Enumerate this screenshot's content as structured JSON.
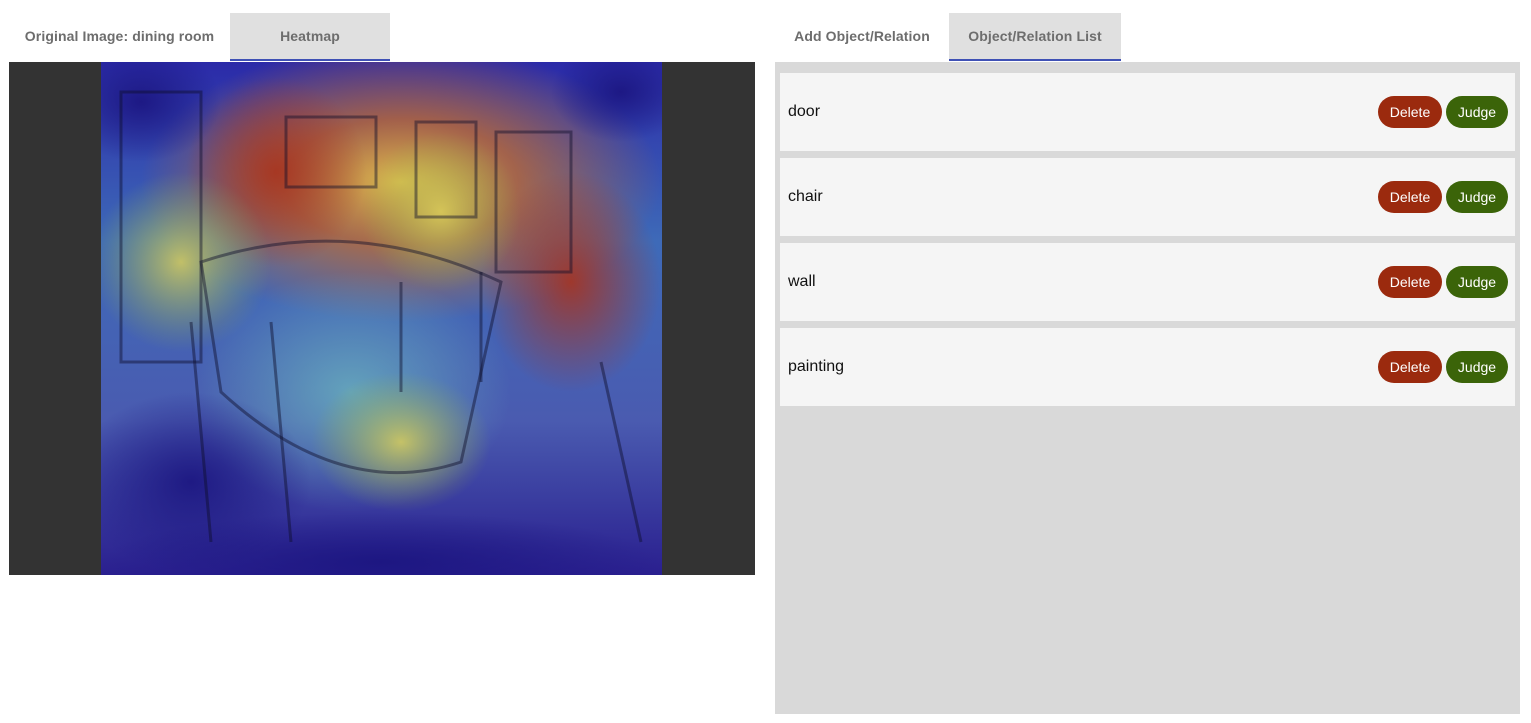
{
  "left": {
    "tabs": [
      {
        "label": "Original Image: dining room",
        "active": false
      },
      {
        "label": "Heatmap",
        "active": true
      }
    ]
  },
  "right": {
    "tabs": [
      {
        "label": "Add Object/Relation",
        "active": false
      },
      {
        "label": "Object/Relation List",
        "active": true
      }
    ],
    "items": [
      {
        "label": "door",
        "delete_label": "Delete",
        "judge_label": "Judge"
      },
      {
        "label": "chair",
        "delete_label": "Delete",
        "judge_label": "Judge"
      },
      {
        "label": "wall",
        "delete_label": "Delete",
        "judge_label": "Judge"
      },
      {
        "label": "painting",
        "delete_label": "Delete",
        "judge_label": "Judge"
      }
    ]
  },
  "colors": {
    "tab_active_bg": "#e0e0e0",
    "tab_indicator": "#3f51b5",
    "delete_button": "#9b2a0e",
    "judge_button": "#3b6409",
    "list_bg": "#d9d9d9",
    "item_bg": "#f5f5f5",
    "image_letterbox": "#333333"
  }
}
